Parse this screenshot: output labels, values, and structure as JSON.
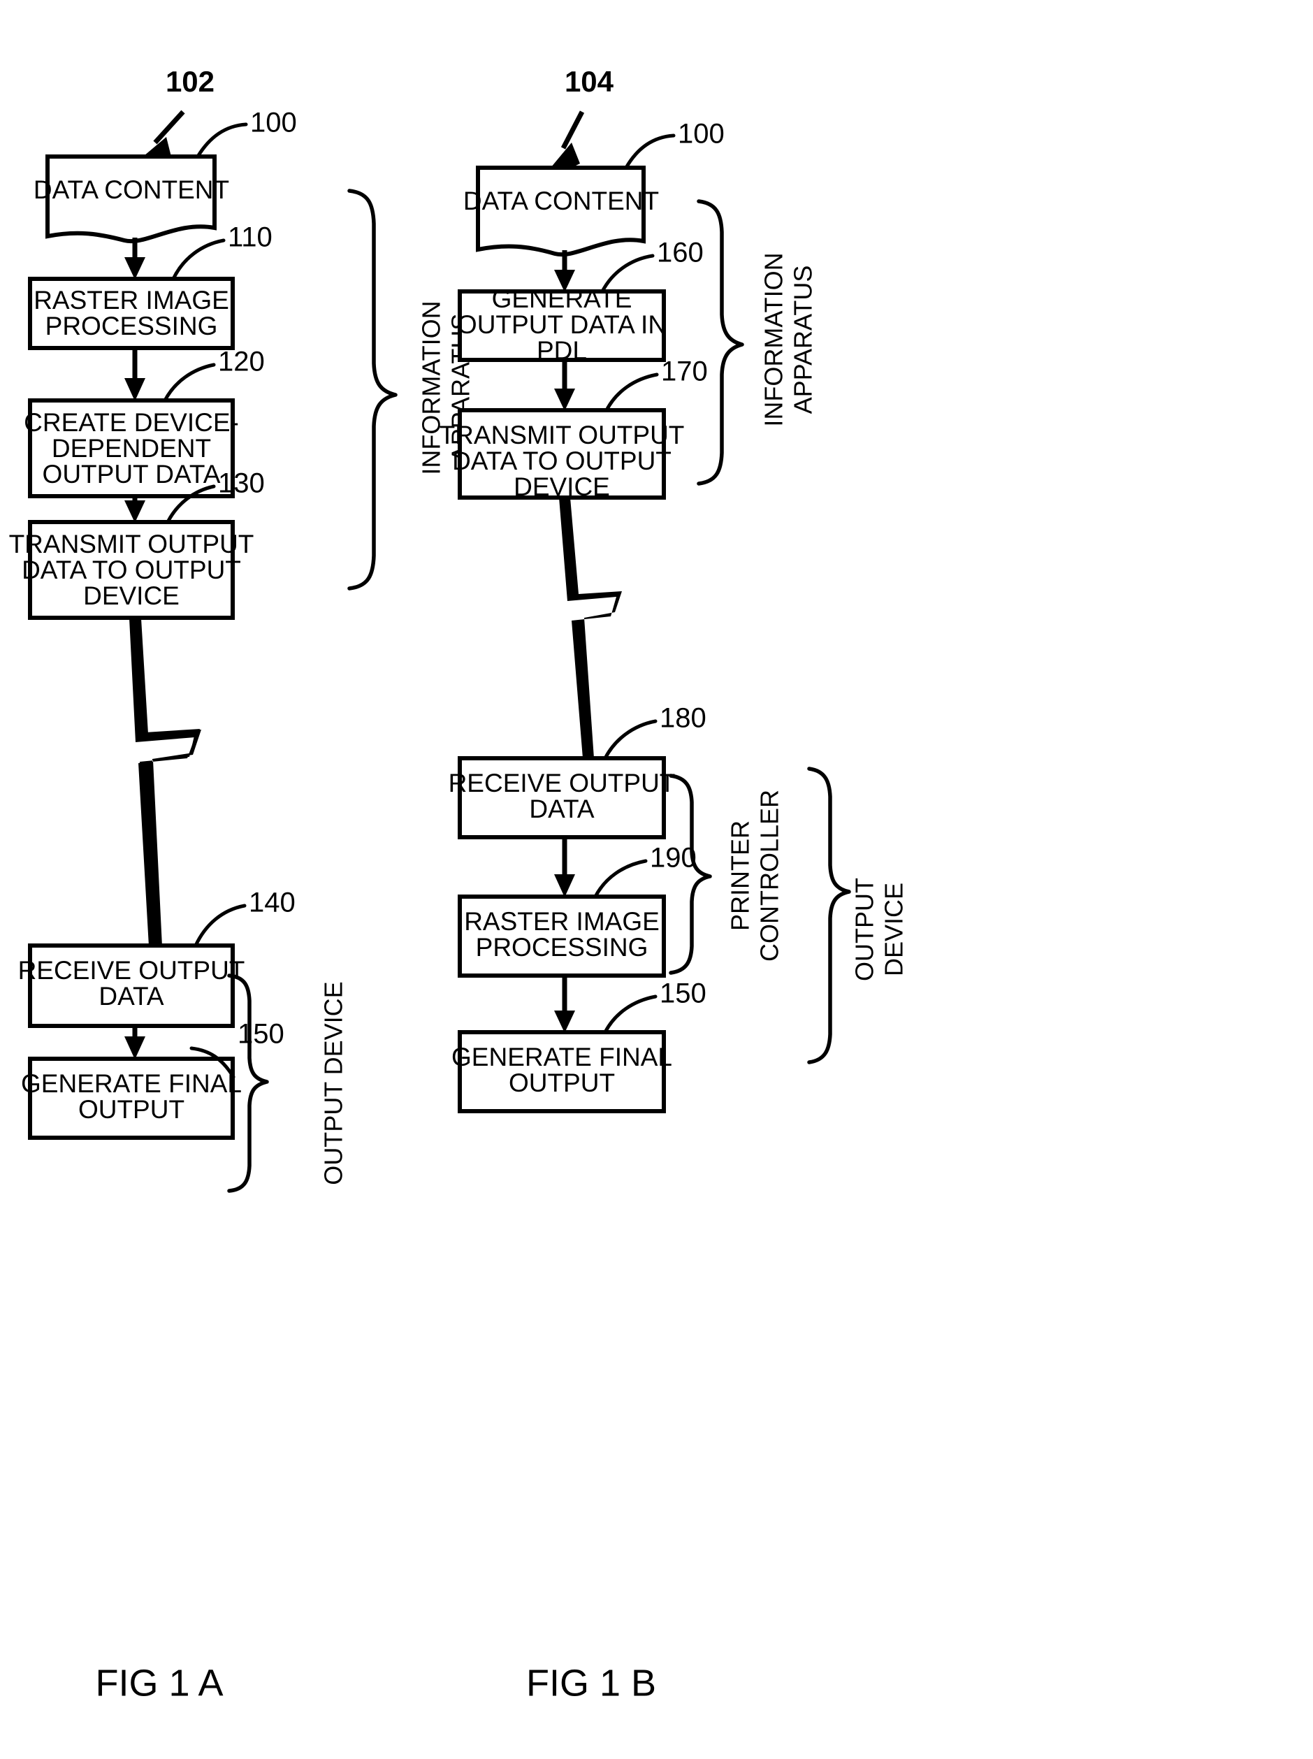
{
  "document": {
    "type": "patent-figure-sheet",
    "figures": [
      {
        "id": "fig-1a",
        "caption": "FIG 1 A",
        "diagram_ref": "102",
        "nodes": [
          {
            "ref": "100",
            "shape": "document",
            "lines": [
              "DATA CONTENT"
            ]
          },
          {
            "ref": "110",
            "shape": "process",
            "lines": [
              "RASTER IMAGE",
              "PROCESSING"
            ]
          },
          {
            "ref": "120",
            "shape": "process",
            "lines": [
              "CREATE DEVICE-",
              "DEPENDENT",
              "OUTPUT DATA"
            ]
          },
          {
            "ref": "130",
            "shape": "process",
            "lines": [
              "TRANSMIT OUTPUT",
              "DATA TO OUTPUT",
              "DEVICE"
            ]
          },
          {
            "ref": "140",
            "shape": "process",
            "lines": [
              "RECEIVE OUTPUT",
              "DATA"
            ]
          },
          {
            "ref": "150",
            "shape": "process",
            "lines": [
              "GENERATE FINAL",
              "OUTPUT"
            ]
          }
        ],
        "groups": [
          {
            "label": "INFORMATION APPARATUS",
            "covers": [
              "100",
              "110",
              "120",
              "130"
            ]
          },
          {
            "label": "OUTPUT DEVICE",
            "covers": [
              "140",
              "150"
            ]
          }
        ],
        "connectors": [
          {
            "from": "100",
            "to": "110",
            "style": "arrow"
          },
          {
            "from": "110",
            "to": "120",
            "style": "arrow"
          },
          {
            "from": "120",
            "to": "130",
            "style": "arrow"
          },
          {
            "from": "130",
            "to": "140",
            "style": "lightning"
          },
          {
            "from": "140",
            "to": "150",
            "style": "arrow"
          }
        ]
      },
      {
        "id": "fig-1b",
        "caption": "FIG 1 B",
        "diagram_ref": "104",
        "nodes": [
          {
            "ref": "100",
            "shape": "document",
            "lines": [
              "DATA CONTENT"
            ]
          },
          {
            "ref": "160",
            "shape": "process",
            "lines": [
              "GENERATE",
              "OUTPUT DATA IN",
              "PDL"
            ]
          },
          {
            "ref": "170",
            "shape": "process",
            "lines": [
              "TRANSMIT OUTPUT",
              "DATA TO OUTPUT",
              "DEVICE"
            ]
          },
          {
            "ref": "180",
            "shape": "process",
            "lines": [
              "RECEIVE OUTPUT",
              "DATA"
            ]
          },
          {
            "ref": "190",
            "shape": "process",
            "lines": [
              "RASTER IMAGE",
              "PROCESSING"
            ]
          },
          {
            "ref": "150",
            "shape": "process",
            "lines": [
              "GENERATE FINAL",
              "OUTPUT"
            ]
          }
        ],
        "groups": [
          {
            "label": "INFORMATION APPARATUS",
            "covers": [
              "100",
              "160",
              "170"
            ]
          },
          {
            "label": "PRINTER CONTROLLER",
            "covers": [
              "180",
              "190"
            ]
          },
          {
            "label": "OUTPUT DEVICE",
            "covers": [
              "180",
              "190",
              "150"
            ]
          }
        ],
        "connectors": [
          {
            "from": "100",
            "to": "160",
            "style": "arrow"
          },
          {
            "from": "160",
            "to": "170",
            "style": "arrow"
          },
          {
            "from": "170",
            "to": "180",
            "style": "lightning"
          },
          {
            "from": "180",
            "to": "190",
            "style": "arrow"
          },
          {
            "from": "190",
            "to": "150",
            "style": "arrow"
          }
        ]
      }
    ]
  },
  "figA": {
    "caption": "FIG 1 A",
    "ref_diagram": "102",
    "box_data_content": {
      "line1": "DATA CONTENT",
      "ref": "100"
    },
    "box_rip": {
      "line1": "RASTER IMAGE",
      "line2": "PROCESSING",
      "ref": "110"
    },
    "box_create": {
      "line1": "CREATE DEVICE-",
      "line2": "DEPENDENT",
      "line3": "OUTPUT DATA",
      "ref": "120"
    },
    "box_transmit": {
      "line1": "TRANSMIT OUTPUT",
      "line2": "DATA TO OUTPUT",
      "line3": "DEVICE",
      "ref": "130"
    },
    "box_receive": {
      "line1": "RECEIVE OUTPUT",
      "line2": "DATA",
      "ref": "140"
    },
    "box_final": {
      "line1": "GENERATE FINAL",
      "line2": "OUTPUT",
      "ref": "150"
    },
    "group_info": {
      "line1": "INFORMATION",
      "line2": "APPARATUS"
    },
    "group_output": {
      "line1": "OUTPUT DEVICE"
    }
  },
  "figB": {
    "caption": "FIG 1 B",
    "ref_diagram": "104",
    "box_data_content": {
      "line1": "DATA CONTENT",
      "ref": "100"
    },
    "box_generate": {
      "line1": "GENERATE",
      "line2": "OUTPUT DATA IN",
      "line3": "PDL",
      "ref": "160"
    },
    "box_transmit": {
      "line1": "TRANSMIT OUTPUT",
      "line2": "DATA TO OUTPUT",
      "line3": "DEVICE",
      "ref": "170"
    },
    "box_receive": {
      "line1": "RECEIVE OUTPUT",
      "line2": "DATA",
      "ref": "180"
    },
    "box_rip": {
      "line1": "RASTER IMAGE",
      "line2": "PROCESSING",
      "ref": "190"
    },
    "box_final": {
      "line1": "GENERATE FINAL",
      "line2": "OUTPUT",
      "ref": "150"
    },
    "group_info": {
      "line1": "INFORMATION",
      "line2": "APPARATUS"
    },
    "group_printer": {
      "line1": "PRINTER",
      "line2": "CONTROLLER"
    },
    "group_output": {
      "line1": "OUTPUT",
      "line2": "DEVICE"
    }
  },
  "colors": {
    "ink": "#000000",
    "paper": "#ffffff"
  }
}
